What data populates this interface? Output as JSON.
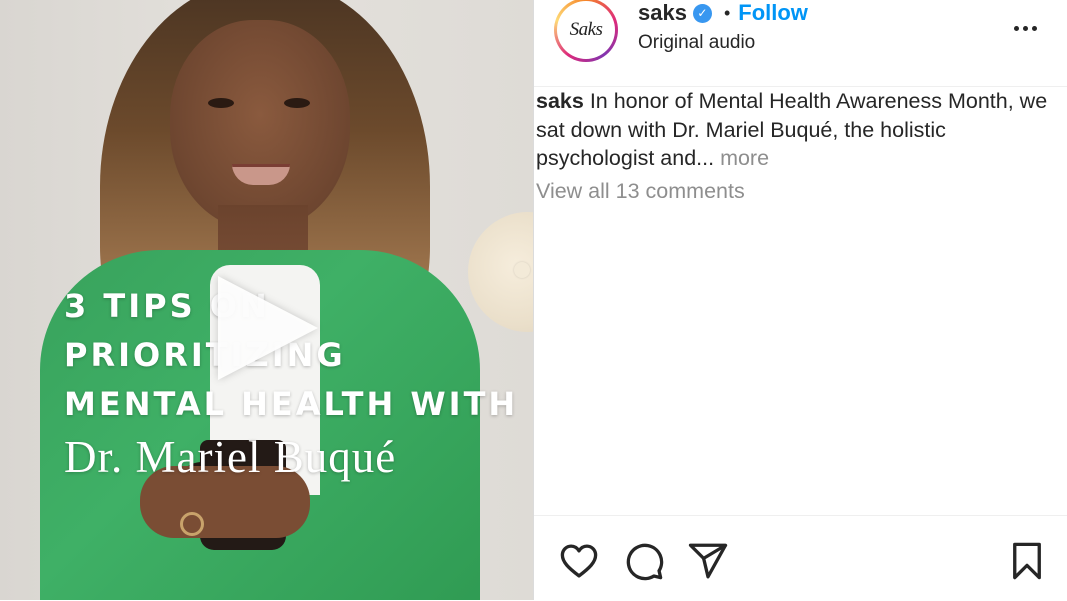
{
  "video": {
    "title_line1": "3 TIPS ON PRIORITIZING",
    "title_line2": "MENTAL HEALTH WITH",
    "title_name": "Dr. Mariel Buqué",
    "play_icon": "play-icon"
  },
  "post": {
    "username": "saks",
    "verified": true,
    "verified_glyph": "✓",
    "separator": "•",
    "follow_label": "Follow",
    "audio": "Original audio",
    "avatar_text": "Saks",
    "caption_user": "saks",
    "caption_text": " In honor of Mental Health Awareness Month, we sat down with Dr. Mariel Buqué, the holistic psychologist and... ",
    "more_label": "more",
    "view_comments": "View all 13 comments"
  },
  "actions": {
    "icons": [
      "heart-icon",
      "comment-icon",
      "share-icon",
      "bookmark-icon"
    ]
  },
  "colors": {
    "follow": "#0095f6",
    "muted": "#8e8e8e",
    "text": "#262626",
    "verified": "#3897f0"
  }
}
